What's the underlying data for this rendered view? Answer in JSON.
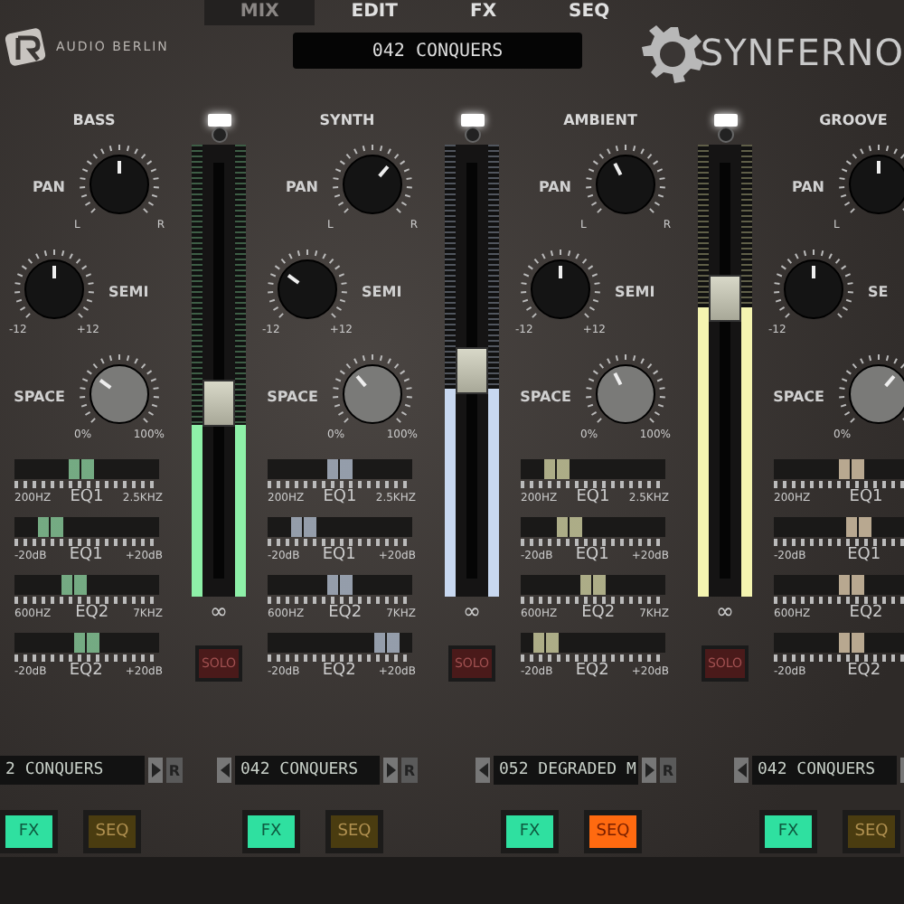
{
  "tabs": [
    {
      "label": "MIX",
      "selected": true
    },
    {
      "label": "EDIT",
      "selected": false
    },
    {
      "label": "FX",
      "selected": false
    },
    {
      "label": "SEQ",
      "selected": false
    }
  ],
  "brand": "AUDIO BERLIN",
  "preset_display": "042 CONQUERS",
  "logo": "SYNFERNO",
  "channels": [
    {
      "name": "BASS",
      "led_on": true,
      "color": "#8ef0a8",
      "fader": {
        "level": 0.42,
        "label": "∞"
      },
      "solo": {
        "label": "SOLO",
        "on": false
      },
      "knobs": [
        {
          "label": "PAN",
          "kind": "dark",
          "level": 0.5,
          "min_label": "L",
          "max_label": "R"
        },
        {
          "label": "SEMI",
          "kind": "dark",
          "level": 0.5,
          "min_label": "-12",
          "max_label": "+12"
        },
        {
          "label": "SPACE",
          "kind": "light",
          "level": 0.3,
          "min_label": "0%",
          "max_label": "100%"
        }
      ],
      "eqs": [
        {
          "label": "EQ1",
          "min_label": "200HZ",
          "max_label": "2.5KHZ",
          "level": 0.45
        },
        {
          "label": "EQ1",
          "min_label": "-20dB",
          "max_label": "+20dB",
          "level": 0.2
        },
        {
          "label": "EQ2",
          "min_label": "600HZ",
          "max_label": "7KHZ",
          "level": 0.4
        },
        {
          "label": "EQ2",
          "min_label": "-20dB",
          "max_label": "+20dB",
          "level": 0.5
        }
      ],
      "preset": {
        "name": "2 CONQUERS",
        "prev_arrow": false,
        "next_arrow": true,
        "reset": "R"
      },
      "fx": {
        "label": "FX",
        "on": true
      },
      "seq": {
        "label": "SEQ",
        "on": false
      }
    },
    {
      "name": "SYNTH",
      "led_on": true,
      "color": "#c8d8f0",
      "fader": {
        "level": 0.5,
        "label": "∞"
      },
      "solo": {
        "label": "SOLO",
        "on": false
      },
      "knobs": [
        {
          "label": "PAN",
          "kind": "dark",
          "level": 0.65,
          "min_label": "L",
          "max_label": "R"
        },
        {
          "label": "SEMI",
          "kind": "dark",
          "level": 0.3,
          "min_label": "-12",
          "max_label": "+12"
        },
        {
          "label": "SPACE",
          "kind": "light",
          "level": 0.35,
          "min_label": "0%",
          "max_label": "100%"
        }
      ],
      "eqs": [
        {
          "label": "EQ1",
          "min_label": "200HZ",
          "max_label": "2.5KHZ",
          "level": 0.5
        },
        {
          "label": "EQ1",
          "min_label": "-20dB",
          "max_label": "+20dB",
          "level": 0.2
        },
        {
          "label": "EQ2",
          "min_label": "600HZ",
          "max_label": "7KHZ",
          "level": 0.5
        },
        {
          "label": "EQ2",
          "min_label": "-20dB",
          "max_label": "+20dB",
          "level": 0.9
        }
      ],
      "preset": {
        "name": "042 CONQUERS",
        "prev_arrow": true,
        "next_arrow": true,
        "reset": "R"
      },
      "fx": {
        "label": "FX",
        "on": true
      },
      "seq": {
        "label": "SEQ",
        "on": false
      }
    },
    {
      "name": "AMBIENT",
      "led_on": true,
      "color": "#f4f4b0",
      "fader": {
        "level": 0.68,
        "label": "∞"
      },
      "solo": {
        "label": "SOLO",
        "on": false
      },
      "knobs": [
        {
          "label": "PAN",
          "kind": "dark",
          "level": 0.4,
          "min_label": "L",
          "max_label": "R"
        },
        {
          "label": "SEMI",
          "kind": "dark",
          "level": 0.5,
          "min_label": "-12",
          "max_label": "+12"
        },
        {
          "label": "SPACE",
          "kind": "light",
          "level": 0.4,
          "min_label": "0%",
          "max_label": "100%"
        }
      ],
      "eqs": [
        {
          "label": "EQ1",
          "min_label": "200HZ",
          "max_label": "2.5KHZ",
          "level": 0.2
        },
        {
          "label": "EQ1",
          "min_label": "-20dB",
          "max_label": "+20dB",
          "level": 0.3
        },
        {
          "label": "EQ2",
          "min_label": "600HZ",
          "max_label": "7KHZ",
          "level": 0.5
        },
        {
          "label": "EQ2",
          "min_label": "-20dB",
          "max_label": "+20dB",
          "level": 0.1
        }
      ],
      "preset": {
        "name": "052 DEGRADED M",
        "prev_arrow": true,
        "next_arrow": true,
        "reset": "R"
      },
      "fx": {
        "label": "FX",
        "on": true
      },
      "seq": {
        "label": "SEQ",
        "on": true
      }
    },
    {
      "name": "GROOVE",
      "knobs": [
        {
          "label": "PAN",
          "kind": "dark",
          "level": 0.5,
          "min_label": "L"
        },
        {
          "label": "SE",
          "kind": "dark",
          "level": 0.5,
          "min_label": "-12"
        },
        {
          "label": "SPACE",
          "kind": "light",
          "level": 0.65,
          "min_label": "0%"
        }
      ],
      "eqs": [
        {
          "label": "EQ1",
          "min_label": "200HZ",
          "level": 0.55
        },
        {
          "label": "EQ1",
          "min_label": "-20dB",
          "level": 0.6
        },
        {
          "label": "EQ2",
          "min_label": "600HZ",
          "level": 0.55
        },
        {
          "label": "EQ2",
          "min_label": "-20dB",
          "level": 0.55
        }
      ],
      "preset": {
        "name": "042 CONQUERS",
        "prev_arrow": true,
        "next_arrow": true
      },
      "fx": {
        "label": "FX",
        "on": true
      },
      "seq": {
        "label": "SEQ",
        "on": false
      }
    }
  ]
}
